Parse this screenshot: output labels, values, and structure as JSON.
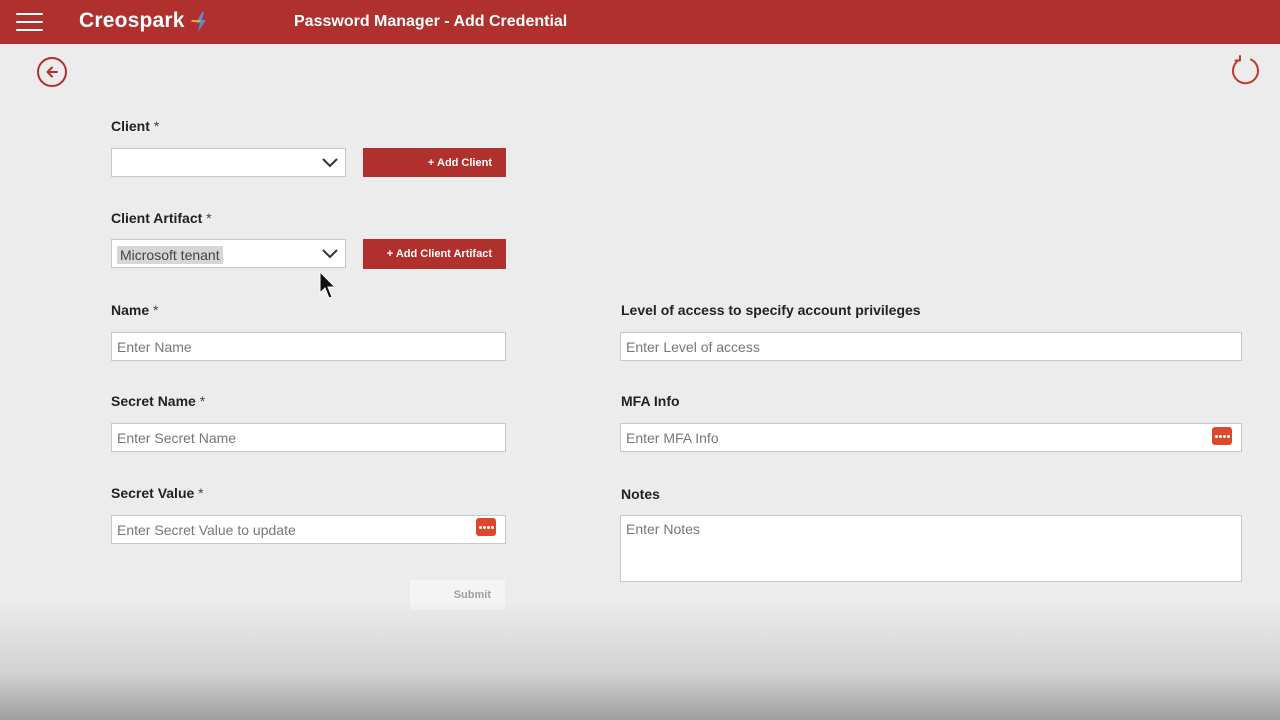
{
  "header": {
    "brand": "Creospark",
    "title": "Password Manager - Add Credential",
    "background": "#b0302d"
  },
  "icons": {
    "menu": "hamburger-menu-icon",
    "back": "back-arrow-icon",
    "refresh": "refresh-icon",
    "password": "password-dots-icon",
    "dropdown": "chevron-down-icon"
  },
  "form": {
    "client": {
      "label": "Client",
      "required": "*",
      "value": "",
      "add_button": "+ Add Client"
    },
    "client_artifact": {
      "label": "Client Artifact",
      "required": "*",
      "value": "Microsoft tenant",
      "add_button": "+ Add Client Artifact"
    },
    "name": {
      "label": "Name",
      "required": "*",
      "placeholder": "Enter Name"
    },
    "secret_name": {
      "label": "Secret Name",
      "required": "*",
      "placeholder": "Enter Secret Name"
    },
    "secret_value": {
      "label": "Secret Value",
      "required": "*",
      "placeholder": "Enter Secret Value to update"
    },
    "level_of_access": {
      "label": "Level of access to specify account privileges",
      "placeholder": "Enter Level of access"
    },
    "mfa_info": {
      "label": "MFA Info",
      "placeholder": "Enter MFA Info"
    },
    "notes": {
      "label": "Notes",
      "placeholder": "Enter Notes"
    },
    "submit": "Submit"
  },
  "colors": {
    "accent": "#b0302d",
    "password_icon": "#e0462b",
    "background": "#ececec"
  }
}
